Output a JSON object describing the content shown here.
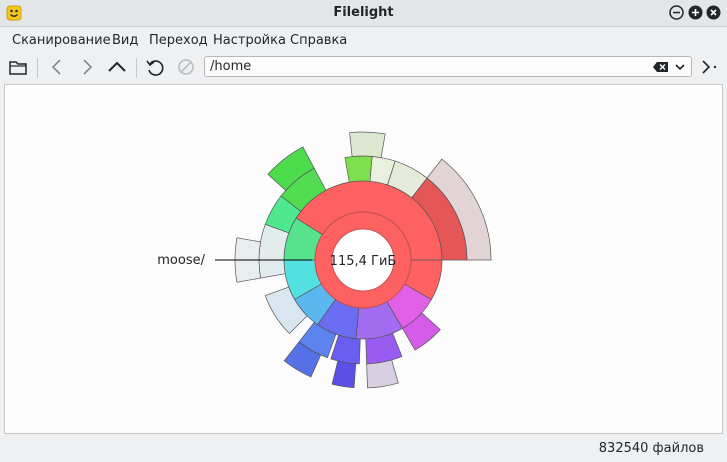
{
  "window": {
    "title": "Filelight",
    "app_icon": "filelight-smiley-icon",
    "controls": [
      "minimize-icon",
      "maximize-icon",
      "close-icon"
    ]
  },
  "menu": {
    "items": [
      {
        "label": "Сканирование"
      },
      {
        "label": "Вид"
      },
      {
        "label": "Переход"
      },
      {
        "label": "Настройка"
      },
      {
        "label": "Справка"
      }
    ]
  },
  "toolbar": {
    "icons": [
      "folder-open-icon",
      "back-icon",
      "forward-icon",
      "up-icon",
      "rescan-icon",
      "stop-icon",
      "more-icon"
    ]
  },
  "location": {
    "value": "/home",
    "clear_icon": "clear-text-icon",
    "dropdown_icon": "chevron-down-icon"
  },
  "radial_map": {
    "center_label": "115,4 ГиБ",
    "hover_label": "moose/",
    "colors": {
      "center": "#fe6161",
      "ring_stroke": "#c05050"
    }
  },
  "status": {
    "files": "832540 файлов"
  }
}
